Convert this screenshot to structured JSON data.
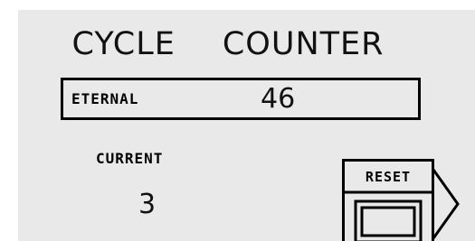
{
  "title": {
    "word1": "CYCLE",
    "word2": "COUNTER"
  },
  "eternal": {
    "label": "ETERNAL",
    "value": "46"
  },
  "current": {
    "label": "CURRENT",
    "value": "3"
  },
  "reset": {
    "label": "RESET"
  },
  "colors": {
    "screen_background": "#e9e9e9",
    "ink": "#000000"
  }
}
